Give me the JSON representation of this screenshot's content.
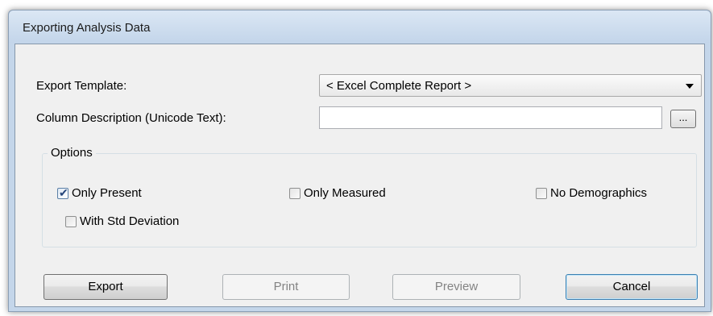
{
  "window": {
    "title": "Exporting Analysis Data"
  },
  "form": {
    "export_template_label": "Export Template:",
    "export_template_value": "< Excel Complete Report >",
    "column_description_label": "Column Description (Unicode Text):",
    "column_description_value": "",
    "browse_button_label": "..."
  },
  "options": {
    "group_label": "Options",
    "only_present": {
      "label": "Only Present",
      "checked": true
    },
    "only_measured": {
      "label": "Only Measured",
      "checked": false
    },
    "no_demographics": {
      "label": "No Demographics",
      "checked": false
    },
    "with_std_deviation": {
      "label": "With Std Deviation",
      "checked": false
    }
  },
  "buttons": {
    "export": "Export",
    "print": "Print",
    "preview": "Preview",
    "cancel": "Cancel"
  },
  "icons": {
    "checkmark": "checkmark-icon",
    "dropdown": "chevron-down-icon"
  }
}
